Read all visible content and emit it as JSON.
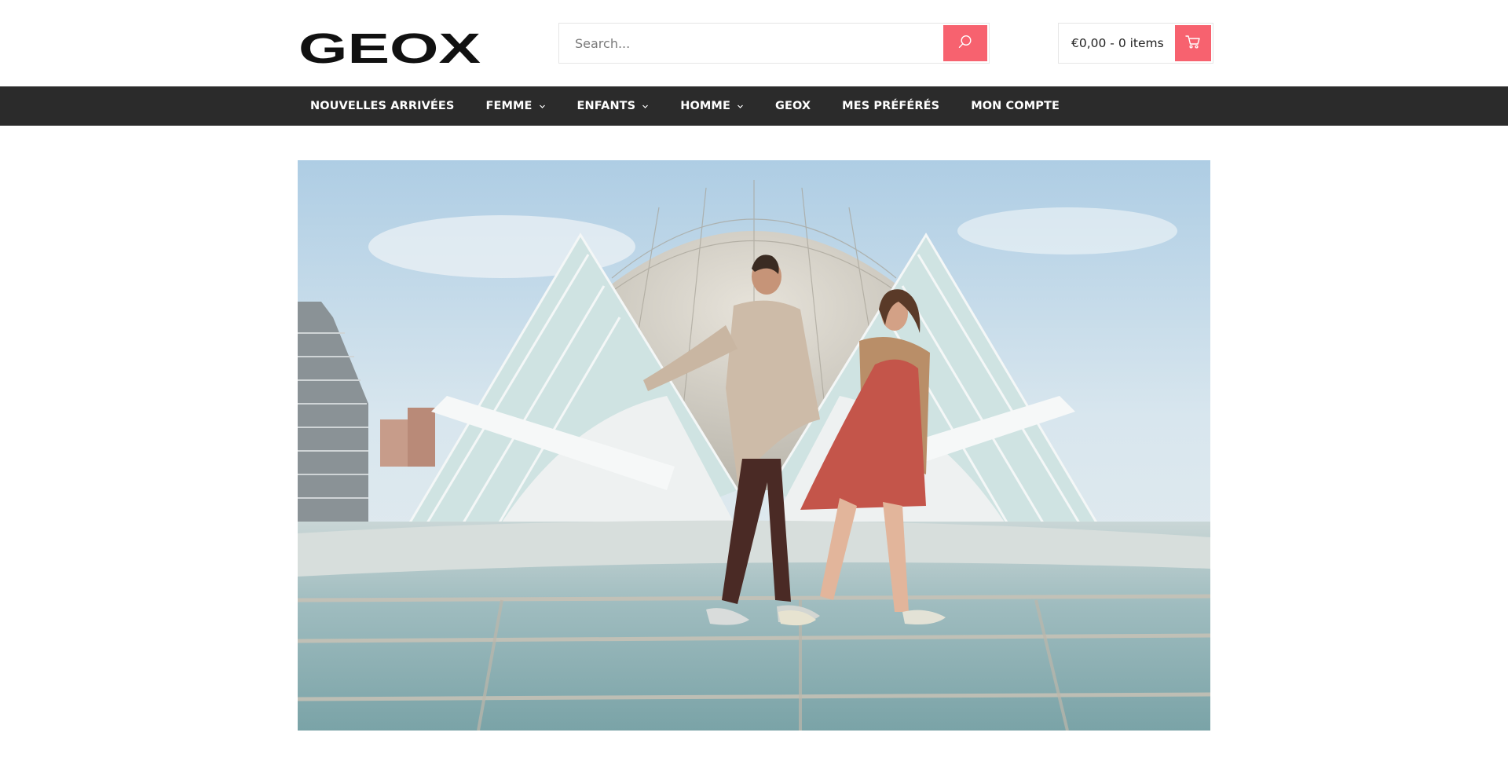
{
  "brand": {
    "logo_text": "GEOX"
  },
  "search": {
    "placeholder": "Search...",
    "icon": "search-icon"
  },
  "cart": {
    "summary": "€0,00 - 0 items",
    "icon": "cart-icon"
  },
  "nav": {
    "items": [
      {
        "label": "NOUVELLES ARRIVÉES",
        "has_dropdown": false
      },
      {
        "label": "FEMME",
        "has_dropdown": true
      },
      {
        "label": "ENFANTS",
        "has_dropdown": true
      },
      {
        "label": "HOMME",
        "has_dropdown": true
      },
      {
        "label": "GEOX",
        "has_dropdown": false
      },
      {
        "label": "MES PRÉFÉRÉS",
        "has_dropdown": false
      },
      {
        "label": "MON COMPTE",
        "has_dropdown": false
      }
    ]
  },
  "colors": {
    "accent": "#f7626f",
    "nav_bg": "#2b2b2b",
    "text": "#222222"
  }
}
